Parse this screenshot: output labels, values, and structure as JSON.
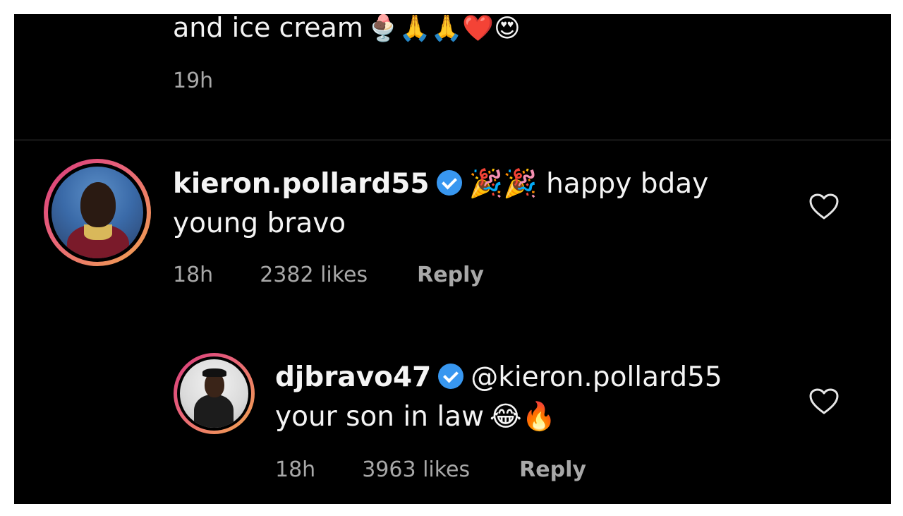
{
  "previous_comment": {
    "text_tail": "and ice cream",
    "emoji": "🍨🙏🙏❤️😍",
    "time": "19h"
  },
  "comments": [
    {
      "username": "kieron.pollard55",
      "verified": true,
      "emoji_prefix": "🎉🎉",
      "text": "happy bday young bravo",
      "time": "18h",
      "likes": "2382 likes",
      "reply_label": "Reply",
      "like_icon": "heart-outline-icon"
    },
    {
      "username": "djbravo47",
      "verified": true,
      "mention": "@kieron.pollard55",
      "text": "your son in law",
      "emoji_suffix": "😂🔥",
      "time": "18h",
      "likes": "3963 likes",
      "reply_label": "Reply",
      "like_icon": "heart-outline-icon"
    }
  ],
  "colors": {
    "background": "#000000",
    "text": "#f4f4f4",
    "meta_text": "#a8a8a8",
    "verified_badge": "#3897f0",
    "story_ring_start": "#d83a7a",
    "story_ring_end": "#f2a64d"
  }
}
